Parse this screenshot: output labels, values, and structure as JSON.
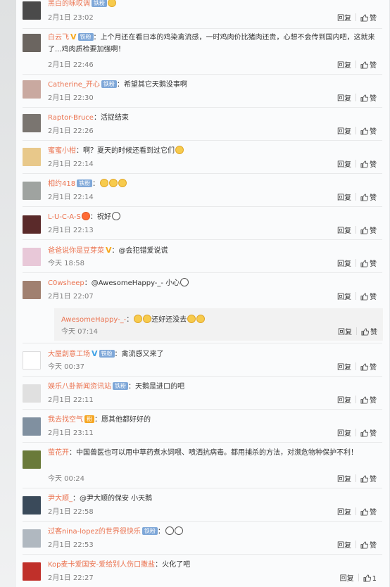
{
  "comments": [
    {
      "author": "黑白的咏叹调",
      "badge": "铁粉",
      "text": "",
      "time": "2月1日 23:02",
      "reply": "回复",
      "like": "赞",
      "avatar_color": "#4a4a4a"
    },
    {
      "author": "白云飞",
      "vmark": "V",
      "badge": "铁粉",
      "text": "：上个月还在看日本的鸡染禽流感，一时鸡肉价比猪肉还贵，心想不会传到国内吧，这就来了...鸡肉质检要加强啊！",
      "time": "2月1日 22:46",
      "reply": "回复",
      "like": "赞",
      "avatar_color": "#6b6560"
    },
    {
      "author": "Catherine_开心",
      "badge": "铁粉",
      "text": "：希望其它天鹅没事啊",
      "time": "2月1日 22:30",
      "reply": "回复",
      "like": "赞",
      "avatar_color": "#c9a9a0"
    },
    {
      "author": "Raptor-Bruce",
      "text": "：活捉结束",
      "time": "2月1日 22:26",
      "reply": "回复",
      "like": "赞",
      "avatar_color": "#7a7570"
    },
    {
      "author": "蜜蜜小柑",
      "text": "：啊？夏天的时候还看到过它们",
      "time": "2月1日 22:14",
      "reply": "回复",
      "like": "赞",
      "avatar_color": "#e8c88a"
    },
    {
      "author": "相约418",
      "badge": "铁粉",
      "text": "：",
      "time": "2月1日 22:14",
      "reply": "回复",
      "like": "赞",
      "avatar_color": "#9fa3a0"
    },
    {
      "author": "L-U-C-A-S",
      "text": "：祝好",
      "time": "2月1日 22:13",
      "reply": "回复",
      "like": "赞",
      "avatar_color": "#5a2a2a"
    },
    {
      "author": "爸爸说你是豆芽菜",
      "vmark": "V",
      "text": "：@会犯错爱说谎",
      "time": "今天 18:58",
      "reply": "回复",
      "like": "赞",
      "avatar_color": "#e8c8d8"
    },
    {
      "author": "C0wsheep",
      "text": "：@AwesomeHappy-_- 小心",
      "time": "2月1日 22:07",
      "reply": "回复",
      "like": "赞",
      "avatar_color": "#a08070"
    },
    {
      "author": "大屋創意工场",
      "vmark": "V",
      "badge": "铁粉",
      "text": "：禽流感又来了",
      "time": "今天 00:37",
      "reply": "回复",
      "like": "赞",
      "avatar_color": "#ffffff"
    },
    {
      "author": "娱乐八卦新闻资讯站",
      "badge": "铁粉",
      "text": "：天鹅是进口的吧",
      "time": "2月1日 22:11",
      "reply": "回复",
      "like": "赞",
      "avatar_color": "#e0e0e0"
    },
    {
      "author": "我去找空气",
      "badge2": "粉",
      "text": "：愿其他都好好的",
      "time": "2月1日 23:11",
      "reply": "回复",
      "like": "赞",
      "avatar_color": "#8090a0"
    },
    {
      "author": "萤花开",
      "text": "：中国兽医也可以用中草药煮水饲喂、喷洒抗病毒。都用捕杀的方法，对濒危物种保护不利！",
      "time": "今天 00:24",
      "reply": "回复",
      "like": "赞",
      "avatar_color": "#6a7a3a"
    },
    {
      "author": "尹大顺_",
      "text": "：@尹大顺的保安 小天鹅",
      "time": "2月1日 22:58",
      "reply": "回复",
      "like": "赞",
      "avatar_color": "#3a4a5a"
    },
    {
      "author": "过客nina-lopez的世界很快乐",
      "badge": "铁粉",
      "text": "：",
      "time": "2月1日 22:53",
      "reply": "回复",
      "like": "赞",
      "avatar_color": "#b0b8c0"
    },
    {
      "author": "Kop麦卡爱国安-爱给别人伤口撒盐",
      "text": "：火化了吧",
      "time": "2月1日 22:27",
      "reply": "回复",
      "like": "1",
      "avatar_color": "#c0302a"
    }
  ],
  "subreply": {
    "author": "AwesomeHappy-_-",
    "text": "：",
    "text2": "还好还没去",
    "time": "今天 07:14",
    "reply": "回复",
    "like": "赞"
  }
}
